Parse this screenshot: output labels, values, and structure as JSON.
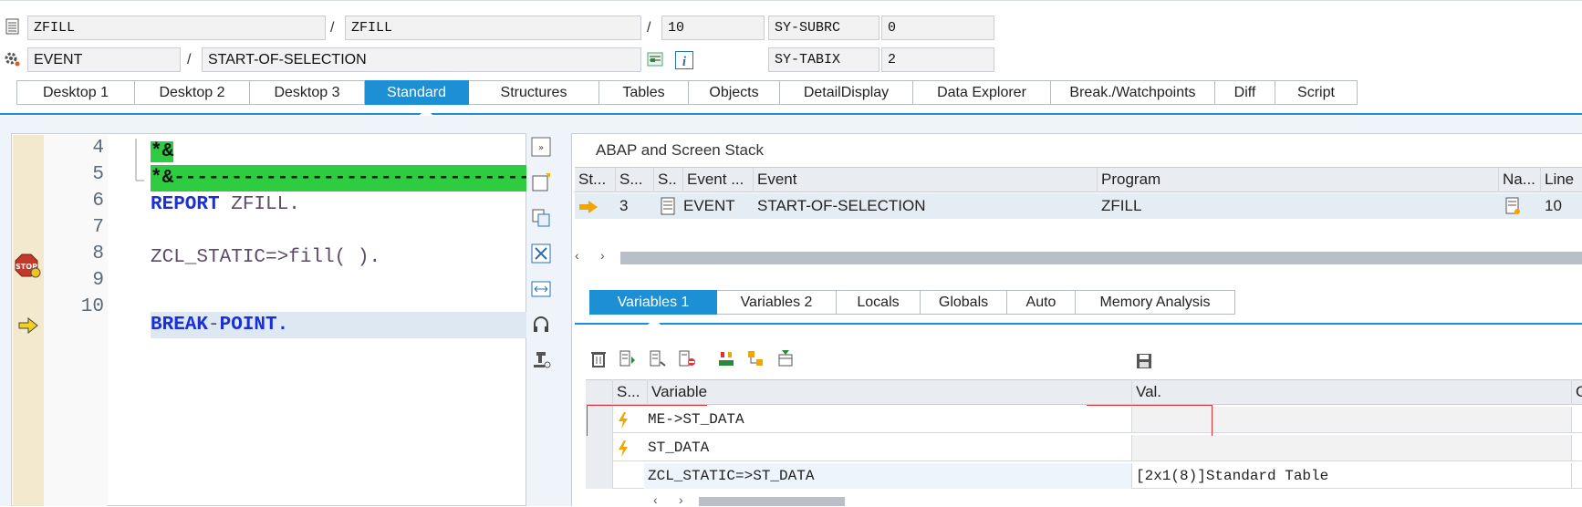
{
  "header": {
    "row1": {
      "program_field": "ZFILL",
      "include_field": "ZFILL",
      "line_field": "10",
      "sysvar_label": "SY-SUBRC",
      "sysvar_value": "0"
    },
    "row2": {
      "type_field": "EVENT",
      "event_field": "START-OF-SELECTION",
      "sysvar_label": "SY-TABIX",
      "sysvar_value": "2"
    },
    "slash": "/"
  },
  "tabs": [
    {
      "label": "Desktop 1"
    },
    {
      "label": "Desktop 2"
    },
    {
      "label": "Desktop 3"
    },
    {
      "label": "Standard"
    },
    {
      "label": "Structures"
    },
    {
      "label": "Tables"
    },
    {
      "label": "Objects"
    },
    {
      "label": "DetailDisplay"
    },
    {
      "label": "Data Explorer"
    },
    {
      "label": "Break./Watchpoints"
    },
    {
      "label": "Diff"
    },
    {
      "label": "Script"
    }
  ],
  "active_tab": "Standard",
  "code": {
    "line_numbers": [
      "4",
      "5",
      "6",
      "7",
      "8",
      "9",
      "10"
    ],
    "lines": {
      "l4": "*&",
      "l5": "*&---------------------------------------",
      "l6_kw": "REPORT",
      "l6_rest": " ZFILL.",
      "l8": "ZCL_STATIC=>fill( ).",
      "l10_kw1": "BREAK",
      "l10_dash": "-",
      "l10_kw2": "POINT",
      "l10_dot": "."
    },
    "breakpoint_line": "8",
    "current_line": "10"
  },
  "stack": {
    "title": "ABAP and Screen Stack",
    "columns": [
      "St...",
      "S...",
      "S..",
      "Event ...",
      "Event",
      "Program",
      "Na...",
      "Line"
    ],
    "row": {
      "level": "3",
      "event_type": "EVENT",
      "event": "START-OF-SELECTION",
      "program": "ZFILL",
      "line": "10"
    }
  },
  "var_tabs": [
    {
      "label": "Variables 1"
    },
    {
      "label": "Variables 2"
    },
    {
      "label": "Locals"
    },
    {
      "label": "Globals"
    },
    {
      "label": "Auto"
    },
    {
      "label": "Memory Analysis"
    }
  ],
  "variables": {
    "columns": {
      "s": "S...",
      "variable": "Variable",
      "value": "Val.",
      "c": "C"
    },
    "rows": [
      {
        "variable": "ME->ST_DATA",
        "value": ""
      },
      {
        "variable": "ST_DATA",
        "value": ""
      },
      {
        "variable": "ZCL_STATIC=>ST_DATA",
        "value": "[2x1(8)]Standard Table"
      }
    ]
  },
  "colors": {
    "accent": "#1d8fd4",
    "green_highlight": "#2ecc40",
    "keyword": "#1a2fd6"
  }
}
